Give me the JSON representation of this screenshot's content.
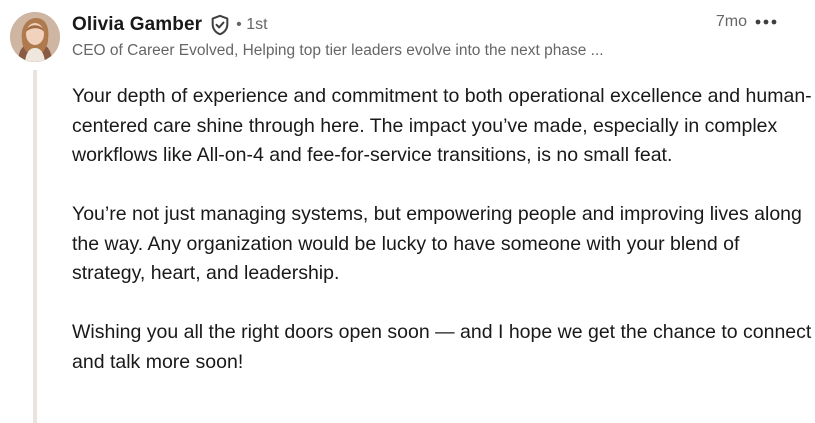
{
  "comment": {
    "author": {
      "name": "Olivia Gamber",
      "degree": "• 1st",
      "headline": "CEO of Career Evolved, Helping top tier leaders evolve into the next phase ...",
      "avatar_icon": "profile-photo",
      "verified_icon": "verified-shield-icon"
    },
    "timestamp": "7mo",
    "more_icon": "more-options-icon",
    "paragraphs": [
      "Your depth of experience and commitment to both operational excellence and human-centered care shine through here. The impact you’ve made, especially in complex workflows like All-on-4 and fee-for-service transitions, is no small feat.",
      "You’re not just managing systems, but empowering people and improving lives along the way. Any organization would be lucky to have someone with your blend of strategy, heart, and leadership.",
      "Wishing you all the right doors open soon — and I hope we get the chance to connect and talk more soon!"
    ]
  },
  "colors": {
    "text_primary": "#191919",
    "text_secondary": "#666666",
    "thread_line": "#e8e5e0"
  }
}
